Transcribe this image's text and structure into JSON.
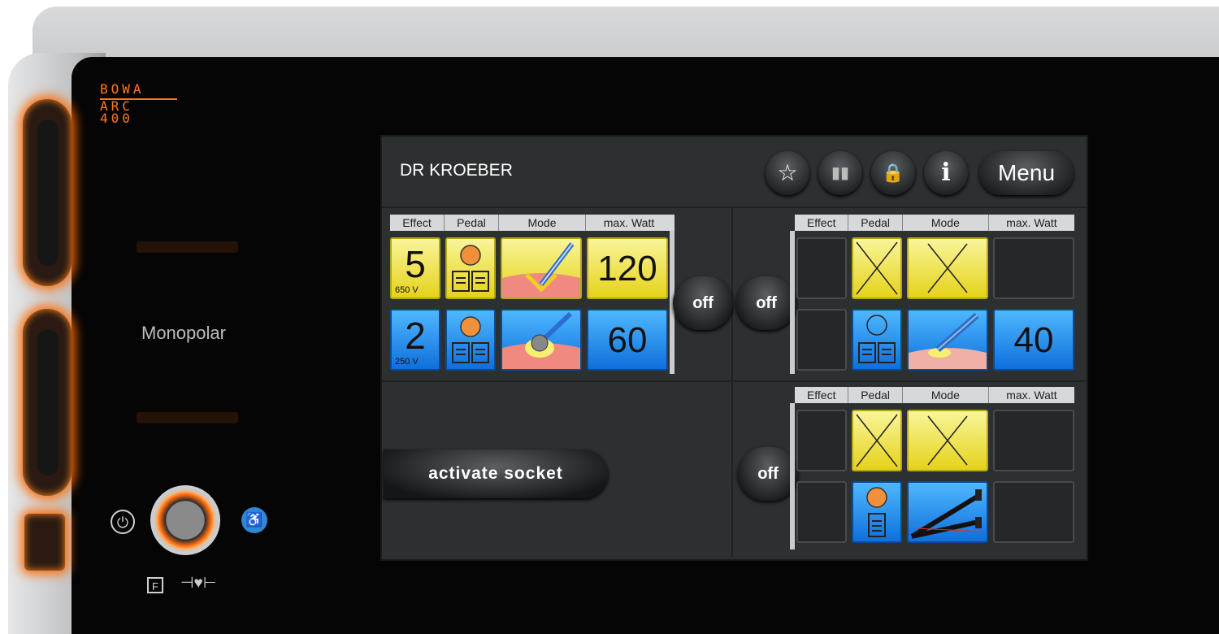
{
  "device": {
    "logo_line1": "BOWA",
    "logo_line2": "ARC",
    "logo_line3": "400",
    "mode_label": "Monopolar",
    "power_symbol": "⏻",
    "f_label": "F",
    "heart_label": "⊣♥⊢",
    "accent_color": "#ff7a1a"
  },
  "screen": {
    "user_name": "DR KROEBER",
    "toolbar": {
      "favorite_icon": "☆",
      "book_icon": "▮▮",
      "lock_icon": "🔒",
      "info_icon": "i",
      "menu_label": "Menu"
    },
    "channel_headers": [
      "Effect",
      "Pedal",
      "Mode",
      "max. Watt"
    ],
    "channel_left": {
      "row1": {
        "effect": "5",
        "voltage": "650 V",
        "max_watt": "120",
        "color": "yellow"
      },
      "row2": {
        "effect": "2",
        "voltage": "250 V",
        "max_watt": "60",
        "color": "blue"
      },
      "off_label": "off"
    },
    "channel_right_top": {
      "row2": {
        "max_watt": "40"
      },
      "off_label": "off"
    },
    "channel_right_bottom": {
      "off_label": "off"
    },
    "activate_label": "activate socket"
  }
}
